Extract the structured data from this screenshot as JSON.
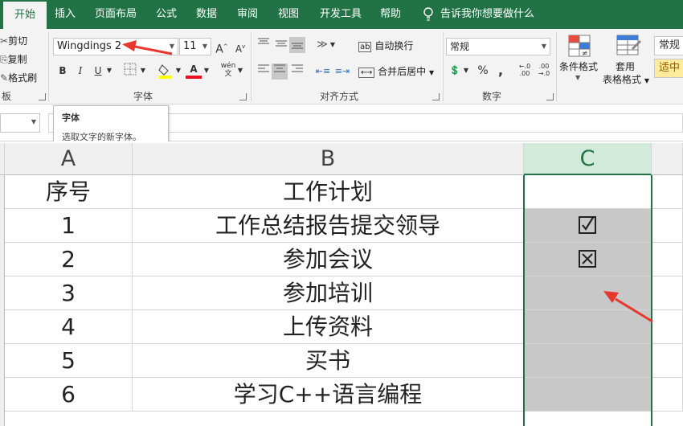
{
  "menu": {
    "tabs": [
      "开始",
      "插入",
      "页面布局",
      "公式",
      "数据",
      "审阅",
      "视图",
      "开发工具",
      "帮助"
    ],
    "tell_me": "告诉我你想要做什么"
  },
  "clipboard": {
    "cut": "剪切",
    "copy": "复制",
    "format_painter": "格式刷",
    "group_label": "板"
  },
  "font": {
    "name": "Wingdings 2",
    "size": "11",
    "group_label": "字体",
    "bold": "B",
    "italic": "I",
    "underline": "U",
    "grow": "A",
    "shrink": "A",
    "phonetic": "wén",
    "font_color_icon": "A"
  },
  "alignment": {
    "wrap": "自动换行",
    "merge": "合并后居中",
    "group_label": "对齐方式"
  },
  "number": {
    "format": "常规",
    "percent": "%",
    "comma": ",",
    "group_label": "数字",
    "inc_dec": "←.0 .00",
    "dec_dec": ".00 →.0"
  },
  "styles": {
    "conditional": "条件格式",
    "table_line1": "套用",
    "table_line2": "表格格式",
    "normal": "常规",
    "neutral": "适中"
  },
  "tooltip": {
    "title": "字体",
    "desc": "选取文字的新字体。"
  },
  "colors": {
    "accent": "#217346",
    "neutral_bg": "#ffeb9c",
    "cell_gray": "#c8c8c8",
    "arrow": "#e8372c"
  },
  "sheet": {
    "columns": [
      "A",
      "B",
      "C"
    ],
    "rows": [
      {
        "a": "序号",
        "b": "工作计划",
        "c": ""
      },
      {
        "a": "1",
        "b": "工作总结报告提交领导",
        "c": "check"
      },
      {
        "a": "2",
        "b": "参加会议",
        "c": "x"
      },
      {
        "a": "3",
        "b": "参加培训",
        "c": ""
      },
      {
        "a": "4",
        "b": "上传资料",
        "c": ""
      },
      {
        "a": "5",
        "b": "买书",
        "c": ""
      },
      {
        "a": "6",
        "b": "学习C++语言编程",
        "c": ""
      }
    ]
  }
}
